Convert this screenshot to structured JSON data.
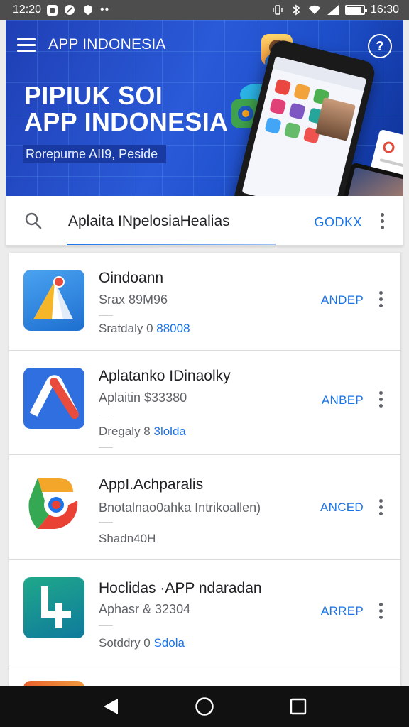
{
  "status_bar": {
    "time_left": "12:20",
    "time_right": "16:30",
    "overflow": "••"
  },
  "header": {
    "title": "APP INDONESIA",
    "hero_line1": "PIPIUK SOI",
    "hero_line2": "APP INDONESIA",
    "tagline": "Rorepurne AII9, Peside",
    "help_icon": "help-icon"
  },
  "search": {
    "query": "Aplaita INpelosiaHealias",
    "action_label": "GODKX",
    "icon": "search-icon"
  },
  "apps": [
    {
      "name": "Oindoann",
      "subtitle": "Srax 89M96",
      "meta_prefix": "Sratdaly 0 ",
      "meta_highlight": "88008",
      "action": "ANDEP"
    },
    {
      "name": "Aplatanko IDinaolky",
      "subtitle": "Aplaitin $33380",
      "meta_prefix": "Dregaly 8 ",
      "meta_highlight": "3lolda",
      "action": "ANBEP"
    },
    {
      "name": "AppI.Achparalis",
      "subtitle": "Bnotalnao0ahka Intrikoallen)",
      "meta_prefix": "Shadn40H",
      "meta_highlight": "",
      "action": "ANCED"
    },
    {
      "name": "Hoclidas ·APP ndaradan",
      "subtitle": "Aphasr & 32304",
      "meta_prefix": "Sotddry 0 ",
      "meta_highlight": "Sdola",
      "action": "ARREP"
    }
  ],
  "nav": {
    "back": "back-icon",
    "home": "home-icon",
    "recents": "recents-icon"
  },
  "colors": {
    "accent": "#1a73e8",
    "banner": "#2a5ad8",
    "nav": "#111111"
  }
}
